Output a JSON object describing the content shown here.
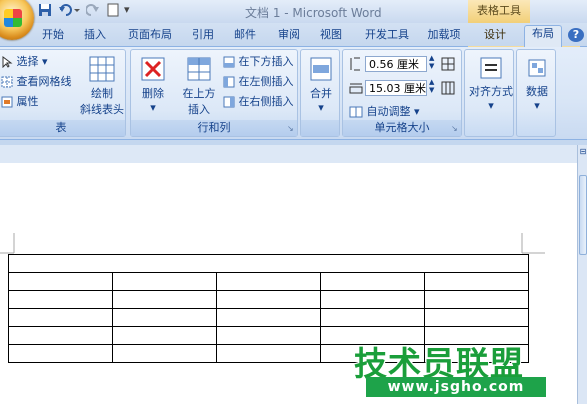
{
  "window": {
    "title": "文档 1 - Microsoft Word",
    "contextual_tab_group": "表格工具"
  },
  "tabs": [
    "开始",
    "插入",
    "页面布局",
    "引用",
    "邮件",
    "审阅",
    "视图",
    "开发工具",
    "加载项",
    "设计",
    "布局"
  ],
  "active_tab": "布局",
  "ribbon": {
    "table_group": {
      "label": "表",
      "select": "选择",
      "view_gridlines": "查看网格线",
      "properties": "属性",
      "draw_diagonal_line1": "绘制",
      "draw_diagonal_line2": "斜线表头"
    },
    "rows_cols_group": {
      "label": "行和列",
      "delete": "删除",
      "insert_above_line1": "在上方",
      "insert_above_line2": "插入",
      "insert_below": "在下方插入",
      "insert_left": "在左侧插入",
      "insert_right": "在右侧插入"
    },
    "merge_group": {
      "merge": "合并"
    },
    "cell_size_group": {
      "label": "单元格大小",
      "height_value": "0.56 厘米",
      "width_value": "15.03 厘米",
      "autofit": "自动调整"
    },
    "alignment": {
      "label": "对齐方式"
    },
    "data": {
      "label": "数据"
    }
  },
  "document": {
    "table": {
      "rows": 6,
      "cols": 5
    }
  },
  "watermark": {
    "text": "技术员联盟",
    "url": "www.jsgho.com"
  },
  "colors": {
    "ribbon_text": "#15428b",
    "contextual_tab": "#f2cf78",
    "watermark_green": "#1a9e3a"
  }
}
